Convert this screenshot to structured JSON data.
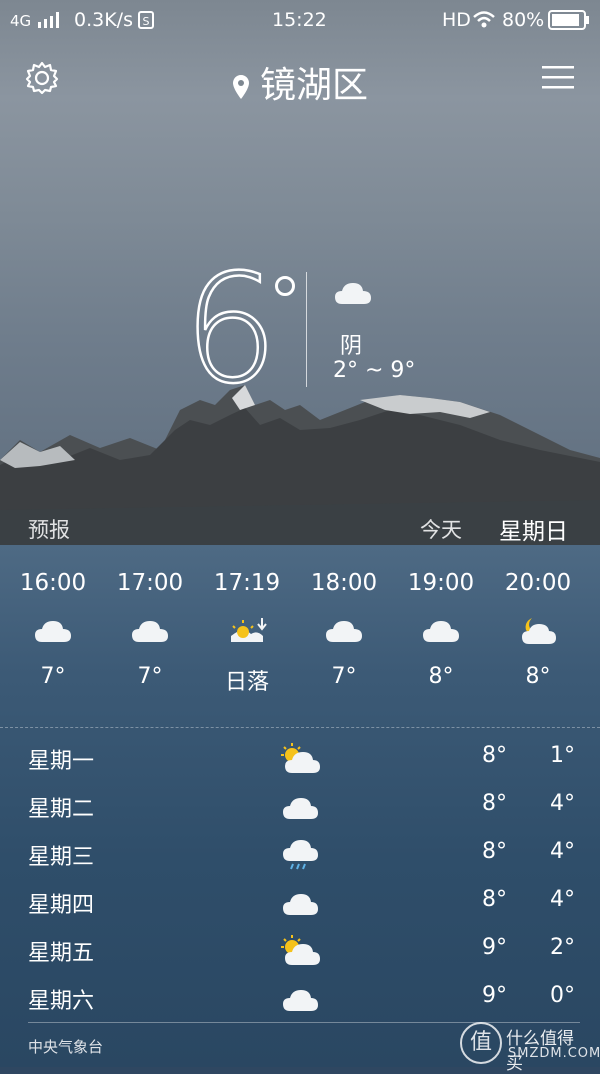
{
  "status": {
    "network": "4G",
    "speed": "0.3K/s",
    "time": "15:22",
    "hd": "HD",
    "battery": "80%"
  },
  "header": {
    "city": "镜湖区",
    "icons": [
      "gear-icon",
      "location-pin-icon",
      "menu-icon"
    ]
  },
  "current": {
    "temp": "6",
    "condition": "阴",
    "range": "2° ~ 9°",
    "icon": "cloud-icon"
  },
  "labels": {
    "forecast": "预报",
    "today": "今天",
    "day_of_week": "星期日"
  },
  "hourly": [
    {
      "time": "16:00",
      "icon": "cloud-icon",
      "value": "7°"
    },
    {
      "time": "17:00",
      "icon": "cloud-icon",
      "value": "7°"
    },
    {
      "time": "17:19",
      "icon": "sunset-icon",
      "value": "日落"
    },
    {
      "time": "18:00",
      "icon": "cloud-icon",
      "value": "7°"
    },
    {
      "time": "19:00",
      "icon": "cloud-icon",
      "value": "8°"
    },
    {
      "time": "20:00",
      "icon": "moon-cloud-icon",
      "value": "8°"
    }
  ],
  "daily": [
    {
      "day": "星期一",
      "icon": "sun-cloud-icon",
      "high": "8°",
      "low": "1°"
    },
    {
      "day": "星期二",
      "icon": "cloud-icon",
      "high": "8°",
      "low": "4°"
    },
    {
      "day": "星期三",
      "icon": "rain-cloud-icon",
      "high": "8°",
      "low": "4°"
    },
    {
      "day": "星期四",
      "icon": "cloud-icon",
      "high": "8°",
      "low": "4°"
    },
    {
      "day": "星期五",
      "icon": "sun-cloud-icon",
      "high": "9°",
      "low": "2°"
    },
    {
      "day": "星期六",
      "icon": "cloud-icon",
      "high": "9°",
      "low": "0°"
    }
  ],
  "footer": {
    "source": "中央气象台",
    "watermark_glyph": "值",
    "watermark_title": "什么值得买",
    "watermark_url": "SMZDM.COM"
  },
  "colors": {
    "sun": "#f5c21b",
    "cloud": "#f2f4f6",
    "rain": "#5fb2e6"
  }
}
